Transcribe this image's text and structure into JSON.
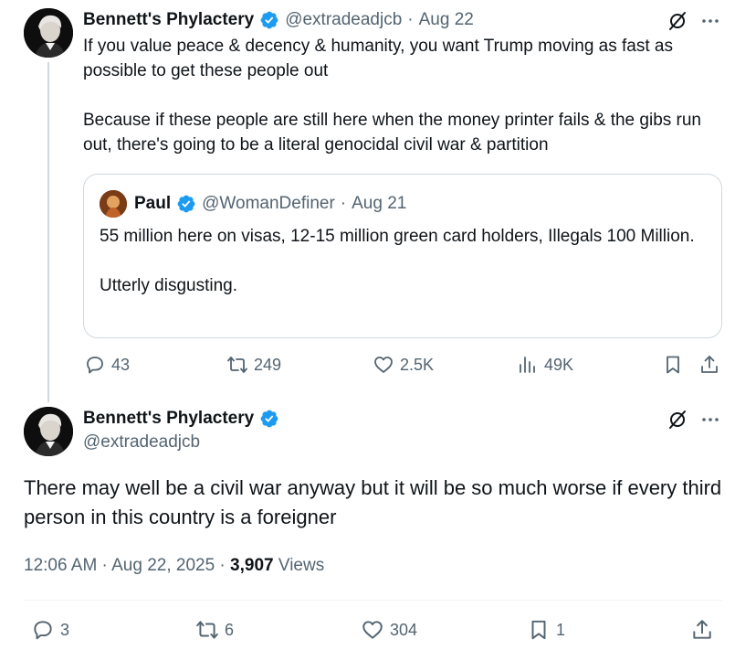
{
  "parent_tweet": {
    "author_name": "Bennett's Phylactery",
    "handle": "@extradeadjcb",
    "sep": "·",
    "date": "Aug 22",
    "text": "If you value peace & decency & humanity, you want Trump moving as fast as possible to get these people out\n\nBecause if these people are still here when the money printer fails & the gibs run out, there's going to be a literal genocidal civil war & partition",
    "quoted": {
      "author_name": "Paul",
      "handle": "@WomanDefiner",
      "sep": "·",
      "date": "Aug 21",
      "text": "55 million here on visas, 12-15 million green card holders, Illegals 100 Million.\n\nUtterly disgusting."
    },
    "actions": {
      "replies": "43",
      "reposts": "249",
      "likes": "2.5K",
      "views": "49K"
    }
  },
  "main_tweet": {
    "author_name": "Bennett's Phylactery",
    "handle": "@extradeadjcb",
    "text": "There may well be a civil war anyway but it will be so much worse if every third person in this country is a foreigner",
    "timestamp": "12:06 AM · Aug 22, 2025 · ",
    "views_count": "3,907",
    "views_label": " Views",
    "actions": {
      "replies": "3",
      "reposts": "6",
      "likes": "304",
      "bookmarks": "1"
    }
  },
  "colors": {
    "verified": "#1d9bf0",
    "secondary_text": "#536471",
    "primary_text": "#0f1419",
    "border": "#cfd9de"
  },
  "icons": [
    "verified-badge-icon",
    "grok-icon",
    "more-icon",
    "reply-icon",
    "repost-icon",
    "like-icon",
    "views-icon",
    "bookmark-icon",
    "share-icon"
  ]
}
